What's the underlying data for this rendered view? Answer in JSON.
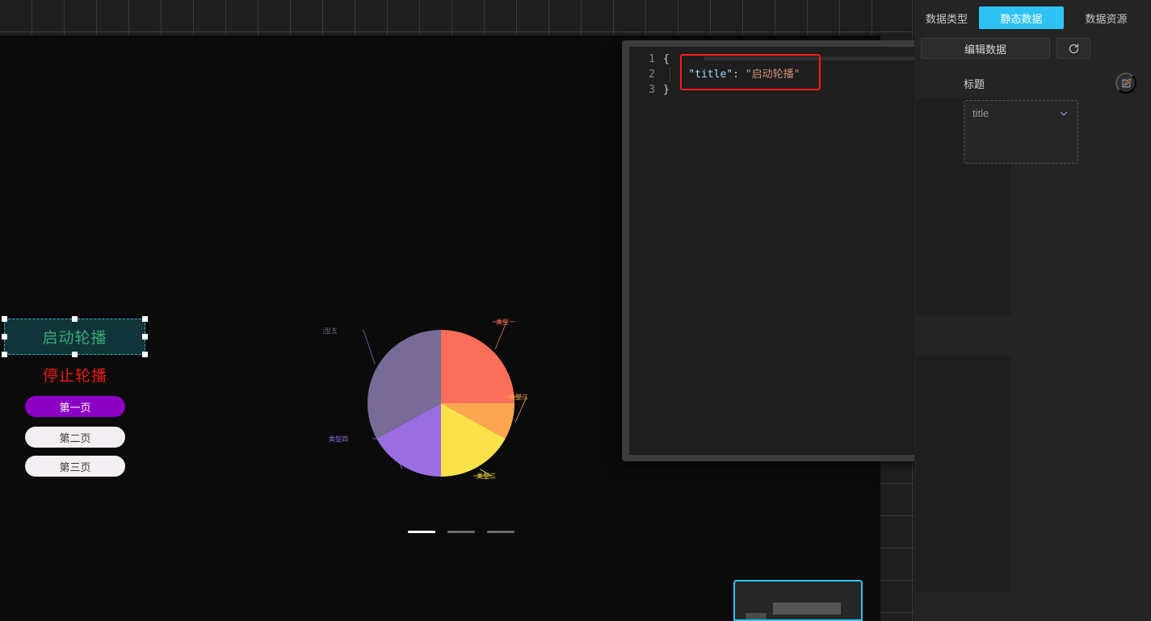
{
  "panel": {
    "tabs": [
      {
        "id": "datatype",
        "label": "数据类型",
        "active": false
      },
      {
        "id": "static",
        "label": "静态数据",
        "active": true
      },
      {
        "id": "resource",
        "label": "数据资源",
        "active": false
      }
    ],
    "edit_data_label": "编辑数据",
    "refresh_icon": "refresh-icon",
    "field": {
      "label": "标题",
      "edit_icon": "edit-pencil-icon",
      "select_value": "title",
      "chevron_icon": "chevron-down-icon"
    }
  },
  "editor": {
    "line_numbers": [
      "1",
      "2",
      "3"
    ],
    "lines": [
      {
        "n": "1",
        "text": "{"
      },
      {
        "n": "2",
        "key": "\"title\"",
        "colon": ": ",
        "value": "\"启动轮播\""
      },
      {
        "n": "3",
        "text": "}"
      }
    ],
    "highlight_note": "red-annotation-box"
  },
  "canvas": {
    "start_button": {
      "label": "启动轮播",
      "selected": true
    },
    "stop_button": {
      "label": "停止轮播"
    },
    "page_buttons": [
      {
        "label": "第一页",
        "active": true
      },
      {
        "label": "第二页",
        "active": false
      },
      {
        "label": "第三页",
        "active": false
      }
    ],
    "carousel_dots": [
      {
        "active": true
      },
      {
        "active": false
      },
      {
        "active": false
      }
    ]
  },
  "colors": {
    "accent_cyan": "#2fc3f5",
    "selection_cyan": "#2fb7d6",
    "start_text_green": "#3aa873",
    "stop_text_red": "#f11a1a",
    "page_active_purple": "#8c00c4",
    "annotation_red": "#ff1a1a"
  },
  "chart_data": {
    "type": "pie",
    "title": "",
    "legend_position": "labels-outside",
    "categories": [
      "类型一",
      "类型二",
      "类型三",
      "类型四",
      "类型五"
    ],
    "values": [
      25,
      8,
      17,
      17,
      33
    ],
    "colors": [
      "#fa6e5a",
      "#fca650",
      "#fbe14a",
      "#9a6ee0",
      "#786b96"
    ],
    "slices": [
      {
        "label": "类型一",
        "value": 25,
        "color": "#fa6e5a",
        "start_angle": 0,
        "end_angle": 90
      },
      {
        "label": "类型二",
        "value": 8,
        "color": "#fca650",
        "start_angle": 90,
        "end_angle": 118
      },
      {
        "label": "类型三",
        "value": 17,
        "color": "#fbe14a",
        "start_angle": 118,
        "end_angle": 180
      },
      {
        "label": "类型四",
        "value": 17,
        "color": "#9a6ee0",
        "start_angle": 180,
        "end_angle": 241
      },
      {
        "label": "类型五",
        "value": 33,
        "color": "#786b96",
        "start_angle": 241,
        "end_angle": 360
      }
    ]
  }
}
